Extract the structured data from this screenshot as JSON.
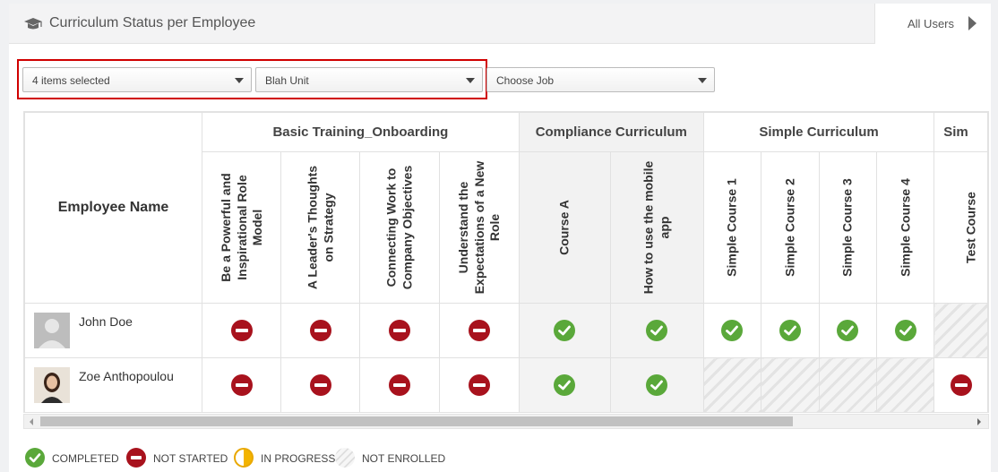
{
  "header": {
    "title": "Curriculum Status per Employee",
    "all_users_label": "All Users",
    "icon": "graduation-cap-icon"
  },
  "filters": [
    {
      "value": "4 items selected"
    },
    {
      "value": "Blah Unit"
    },
    {
      "value": "Choose Job"
    }
  ],
  "grid": {
    "employee_column_label": "Employee Name",
    "groups": [
      {
        "label": "Basic Training_Onboarding",
        "span": 4
      },
      {
        "label": "Compliance Curriculum",
        "span": 2
      },
      {
        "label": "Simple Curriculum",
        "span": 4
      },
      {
        "label": "Sim",
        "span": 1
      }
    ],
    "courses": [
      {
        "label": "Be a Powerful and Inspirational Role Model",
        "group": 0
      },
      {
        "label": "A Leader's Thoughts on Strategy",
        "group": 0
      },
      {
        "label": "Connecting Work to Company Objectives",
        "group": 0
      },
      {
        "label": "Understand the Expectations of a New Role",
        "group": 0
      },
      {
        "label": "Course A",
        "group": 1
      },
      {
        "label": "How to use the mobile app",
        "group": 1
      },
      {
        "label": "Simple Course 1",
        "group": 2
      },
      {
        "label": "Simple Course 2",
        "group": 2
      },
      {
        "label": "Simple Course 3",
        "group": 2
      },
      {
        "label": "Simple Course 4",
        "group": 2
      },
      {
        "label": "Test Course",
        "group": 3
      }
    ],
    "rows": [
      {
        "name": "John Doe",
        "avatar": "default-avatar",
        "statuses": [
          "not_started",
          "not_started",
          "not_started",
          "not_started",
          "completed",
          "completed",
          "completed",
          "completed",
          "completed",
          "completed",
          "not_enrolled"
        ]
      },
      {
        "name": "Zoe Anthopoulou",
        "avatar": "photo-avatar",
        "statuses": [
          "not_started",
          "not_started",
          "not_started",
          "not_started",
          "completed",
          "completed",
          "not_enrolled",
          "not_enrolled",
          "not_enrolled",
          "not_enrolled",
          "not_started"
        ]
      }
    ]
  },
  "legend": {
    "completed": "COMPLETED",
    "not_started": "NOT STARTED",
    "in_progress": "IN PROGRESS",
    "not_enrolled": "NOT ENROLLED"
  },
  "colors": {
    "completed": "#5aa83a",
    "not_started": "#a8121d",
    "in_progress": "#f3b400",
    "highlight_border": "#d00000"
  }
}
